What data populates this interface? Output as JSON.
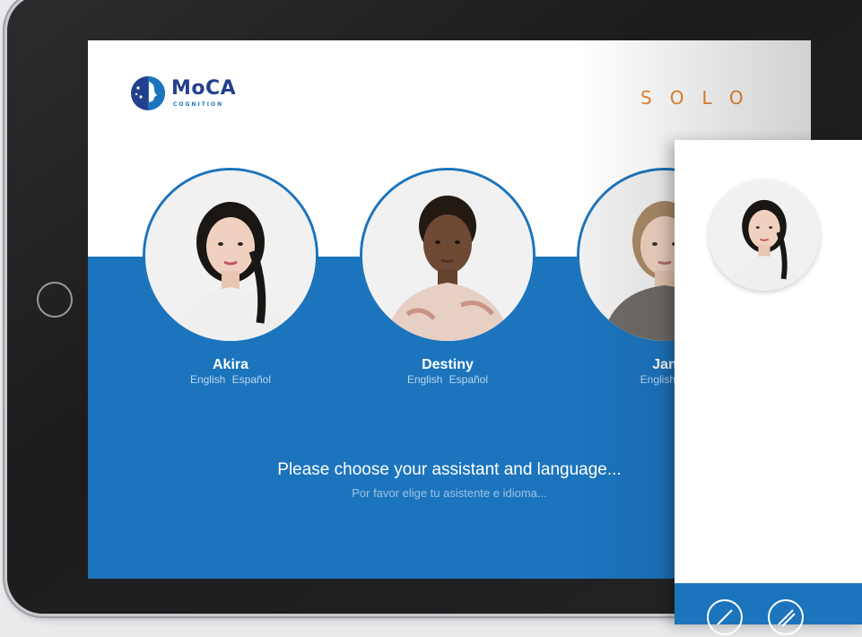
{
  "brand": {
    "name": "MoCA",
    "tagline": "COGNITION",
    "mode": "SOLO",
    "accent": "#1c74bd",
    "mode_color": "#e8862c"
  },
  "assistants": [
    {
      "name": "Akira",
      "lang_en": "English",
      "lang_es": "Español"
    },
    {
      "name": "Destiny",
      "lang_en": "English",
      "lang_es": "Español"
    },
    {
      "name": "Jan",
      "lang_en": "English",
      "lang_es": "E"
    }
  ],
  "prompt": {
    "main": "Please choose your assistant and language...",
    "sub": "Por favor elige tu asistente e idioma..."
  },
  "phone": {
    "icons": [
      "pencil-icon",
      "pen-icon"
    ]
  }
}
